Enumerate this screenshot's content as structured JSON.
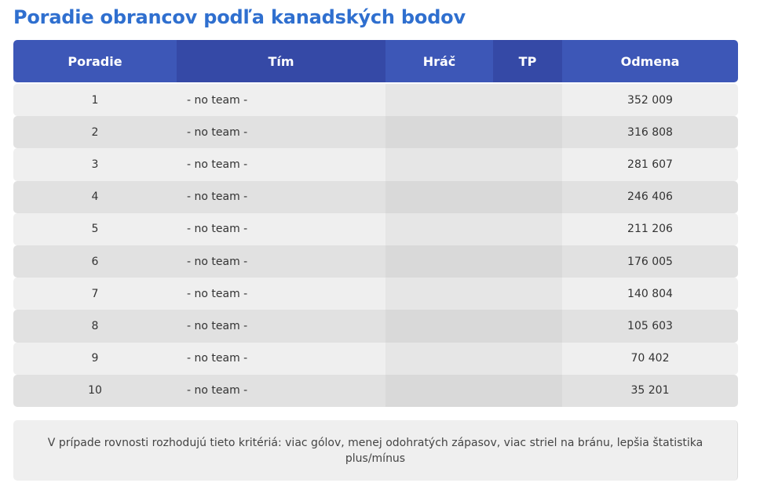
{
  "page_title": "Poradie obrancov podľa kanadských bodov",
  "table": {
    "headers": {
      "rank": "Poradie",
      "team": "Tím",
      "player": "Hráč",
      "tp": "TP",
      "reward": "Odmena"
    },
    "rows": [
      {
        "rank": "1",
        "team": "- no team -",
        "player": "",
        "tp": "",
        "reward": "352 009"
      },
      {
        "rank": "2",
        "team": "- no team -",
        "player": "",
        "tp": "",
        "reward": "316 808"
      },
      {
        "rank": "3",
        "team": "- no team -",
        "player": "",
        "tp": "",
        "reward": "281 607"
      },
      {
        "rank": "4",
        "team": "- no team -",
        "player": "",
        "tp": "",
        "reward": "246 406"
      },
      {
        "rank": "5",
        "team": "- no team -",
        "player": "",
        "tp": "",
        "reward": "211 206"
      },
      {
        "rank": "6",
        "team": "- no team -",
        "player": "",
        "tp": "",
        "reward": "176 005"
      },
      {
        "rank": "7",
        "team": "- no team -",
        "player": "",
        "tp": "",
        "reward": "140 804"
      },
      {
        "rank": "8",
        "team": "- no team -",
        "player": "",
        "tp": "",
        "reward": "105 603"
      },
      {
        "rank": "9",
        "team": "- no team -",
        "player": "",
        "tp": "",
        "reward": "70 402"
      },
      {
        "rank": "10",
        "team": "- no team -",
        "player": "",
        "tp": "",
        "reward": "35 201"
      }
    ]
  },
  "note": "V prípade rovnosti rozhodujú tieto kritériá: viac gólov, menej odohratých zápasov, viac striel na bránu, lepšia štatistika plus/mínus",
  "colors": {
    "title": "#2f6fcf",
    "header_bg": "#3d57b7",
    "header_bg_alt": "#3549a6"
  }
}
